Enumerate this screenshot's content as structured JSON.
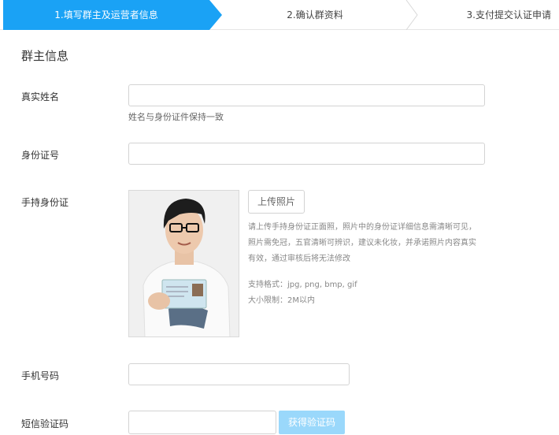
{
  "steps": [
    {
      "label": "1.填写群主及运营者信息"
    },
    {
      "label": "2.确认群资料"
    },
    {
      "label": "3.支付提交认证申请"
    }
  ],
  "section_title": "群主信息",
  "form": {
    "real_name": {
      "label": "真实姓名",
      "value": "",
      "hint": "姓名与身份证件保持一致"
    },
    "id_number": {
      "label": "身份证号",
      "value": ""
    },
    "id_photo": {
      "label": "手持身份证",
      "upload_label": "上传照片",
      "desc_lines": [
        "请上传手持身份证正面照，照片中的身份证详细信息需清晰可见，",
        "照片需免冠，五官清晰可辨识，建议未化妆，并承诺照片内容真实",
        "有效，通过审核后将无法修改"
      ],
      "format_text": "支持格式：jpg, png, bmp, gif",
      "size_text": "大小限制：2M以内"
    },
    "phone": {
      "label": "手机号码",
      "value": ""
    },
    "sms_code": {
      "label": "短信验证码",
      "value": "",
      "button_label": "获得验证码"
    }
  },
  "colors": {
    "primary": "#1aa2f5",
    "disabled_button": "#9ad8fb"
  }
}
